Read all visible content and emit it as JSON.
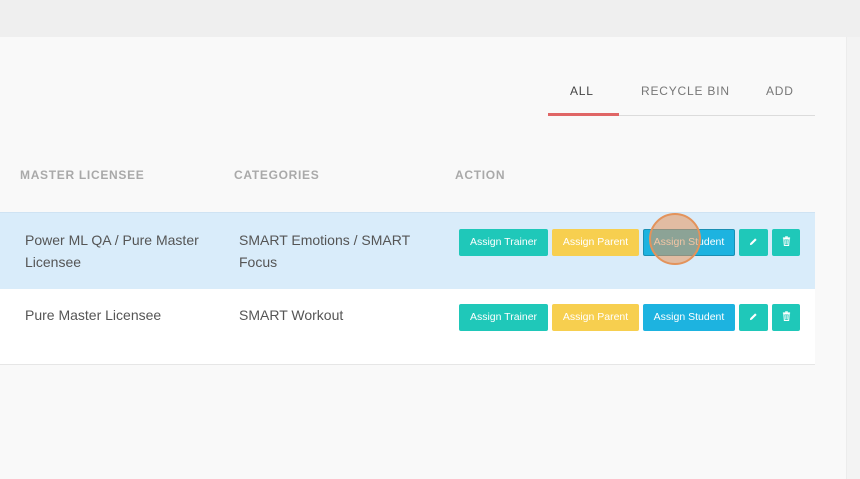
{
  "tabs": [
    {
      "label": "ALL",
      "active": true
    },
    {
      "label": "RECYCLE BIN",
      "active": false
    },
    {
      "label": "ADD",
      "active": false
    }
  ],
  "table": {
    "headers": {
      "master_licensee": "MASTER LICENSEE",
      "categories": "CATEGORIES",
      "action": "ACTION"
    },
    "rows": [
      {
        "master_licensee": "Power ML QA / Pure Master Licensee",
        "categories": "SMART Emotions / SMART Focus",
        "highlighted": true
      },
      {
        "master_licensee": "Pure Master Licensee",
        "categories": "SMART Workout",
        "highlighted": false
      }
    ]
  },
  "actions": {
    "assign_trainer": "Assign Trainer",
    "assign_parent": "Assign Parent",
    "assign_student": "Assign Student",
    "edit_icon": "pencil-icon",
    "delete_icon": "trash-icon"
  },
  "colors": {
    "accent_underline": "#e06666",
    "teal": "#1fc8b9",
    "yellow": "#f7cf4f",
    "blue": "#1db3e0",
    "row_highlight": "#d9ecfa"
  }
}
